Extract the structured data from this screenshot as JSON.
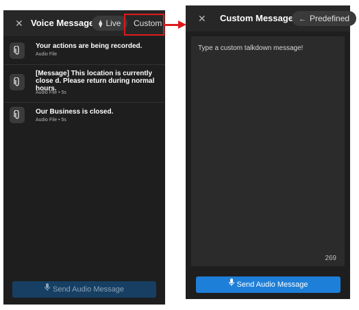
{
  "left": {
    "title": "Voice Messages",
    "close_icon": "close-icon",
    "tabs": [
      {
        "label": "Live",
        "icon": "waveform-icon"
      },
      {
        "label": "Custom"
      }
    ],
    "highlight_color": "#e0191b",
    "messages": [
      {
        "title": "Your actions are being recorded.",
        "meta": "Audio File",
        "icon": "paperclip-icon"
      },
      {
        "title": "[Message] This location is currently close d. Please return during normal hours.",
        "meta": "Audio File • 5s",
        "icon": "paperclip-icon"
      },
      {
        "title": "Our Business is closed.",
        "meta": "Audio File • 5s",
        "icon": "paperclip-icon"
      }
    ],
    "send_button": {
      "label": "Send Audio Message",
      "icon": "microphone-icon",
      "state": "disabled",
      "color": "#163f63"
    }
  },
  "right": {
    "title": "Custom Message",
    "close_icon": "close-icon",
    "back_tab": {
      "label": "Predefined",
      "icon": "arrow-left-icon"
    },
    "textarea": {
      "placeholder": "Type a custom talkdown message!",
      "counter": "269"
    },
    "send_button": {
      "label": "Send Audio Message",
      "icon": "microphone-icon",
      "state": "enabled",
      "color": "#1e7fd8"
    }
  },
  "annotation": {
    "arrow_color": "#e0191b"
  }
}
